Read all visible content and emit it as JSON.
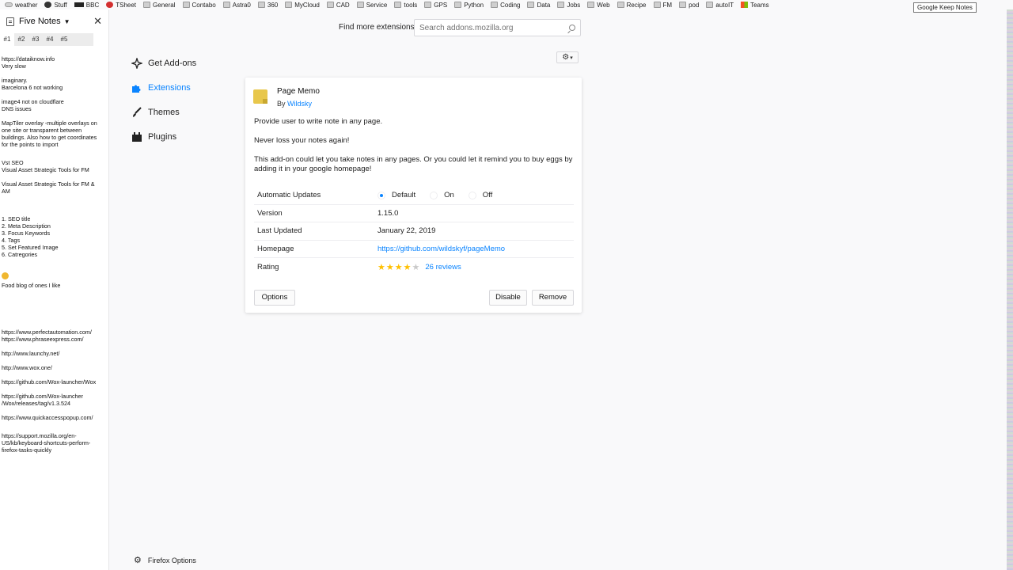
{
  "bookmarks": [
    {
      "label": "weather",
      "icon": "cloud"
    },
    {
      "label": "Stuff",
      "icon": "s"
    },
    {
      "label": "BBC",
      "icon": "bbc"
    },
    {
      "label": "TSheet",
      "icon": "t"
    },
    {
      "label": "General",
      "icon": "folder"
    },
    {
      "label": "Contabo",
      "icon": "folder"
    },
    {
      "label": "Astra0",
      "icon": "folder"
    },
    {
      "label": "360",
      "icon": "folder"
    },
    {
      "label": "MyCloud",
      "icon": "folder"
    },
    {
      "label": "CAD",
      "icon": "folder"
    },
    {
      "label": "Service",
      "icon": "folder"
    },
    {
      "label": "tools",
      "icon": "folder"
    },
    {
      "label": "GPS",
      "icon": "folder"
    },
    {
      "label": "Python",
      "icon": "folder"
    },
    {
      "label": "Coding",
      "icon": "folder"
    },
    {
      "label": "Data",
      "icon": "folder"
    },
    {
      "label": "Jobs",
      "icon": "folder"
    },
    {
      "label": "Web",
      "icon": "folder"
    },
    {
      "label": "Recipe",
      "icon": "folder"
    },
    {
      "label": "FM",
      "icon": "folder"
    },
    {
      "label": "pod",
      "icon": "folder"
    },
    {
      "label": "autoIT",
      "icon": "folder"
    },
    {
      "label": "Teams",
      "icon": "teams"
    }
  ],
  "tooltip": "Google Keep Notes",
  "sidebar": {
    "title": "Five Notes",
    "tabs": [
      "#1",
      "#2",
      "#3",
      "#4",
      "#5"
    ],
    "notes": [
      [
        "https://dataiknow.info",
        "Very slow"
      ],
      [
        "imaginary.",
        "Barcelona 6 not working"
      ],
      [
        "image4 not on cloudflare",
        "DNS issues"
      ],
      [
        "MapTiler overlay -multiple overlays on",
        "one site or transparent between",
        "buildings. Also how to get coordinates",
        "for the points to import"
      ],
      [
        "Vst SEO",
        "Visual Asset Strategic Tools for FM"
      ],
      [
        "Visual Asset Strategic Tools for FM &",
        "AM"
      ],
      [
        "1. SEO title",
        "2. Meta Description",
        "3. Focus Keywords",
        "4. Tags",
        "5. Set Featured Image",
        "6. Catregories"
      ],
      [
        "Food blog of ones I like"
      ],
      [
        "https://www.perfectautomation.com/",
        "https://www.phraseexpress.com/"
      ],
      [
        "http://www.launchy.net/"
      ],
      [
        "http://www.wox.one/"
      ],
      [
        "https://github.com/Wox-launcher/Wox"
      ],
      [
        "https://github.com/Wox-launcher",
        "/Wox/releases/tag/v1.3.524"
      ],
      [
        "https://www.quickaccesspopup.com/"
      ],
      [
        "https://support.mozilla.org/en-",
        "US/kb/keyboard-shortcuts-perform-",
        "firefox-tasks-quickly"
      ]
    ]
  },
  "header": {
    "find_more": "Find more extensions",
    "search_placeholder": "Search addons.mozilla.org"
  },
  "categories": [
    {
      "label": "Get Add-ons",
      "icon": "get-addons-icon",
      "active": false
    },
    {
      "label": "Extensions",
      "icon": "puzzle-icon",
      "active": true
    },
    {
      "label": "Themes",
      "icon": "brush-icon",
      "active": false
    },
    {
      "label": "Plugins",
      "icon": "plugin-icon",
      "active": false
    }
  ],
  "addon": {
    "name": "Page Memo",
    "by": "By",
    "author": "Wildsky",
    "description": [
      "Provide user to write note in any page.",
      "Never loss your notes again!",
      "This add-on could let you take notes in any pages. Or you could let it remind you to buy eggs by adding it in your google homepage!"
    ],
    "auto_updates_label": "Automatic Updates",
    "auto_updates_options": [
      "Default",
      "On",
      "Off"
    ],
    "auto_updates_selected": "Default",
    "version_label": "Version",
    "version": "1.15.0",
    "last_updated_label": "Last Updated",
    "last_updated": "January 22, 2019",
    "homepage_label": "Homepage",
    "homepage": "https://github.com/wildskyf/pageMemo",
    "rating_label": "Rating",
    "rating": 4.5,
    "reviews": "26 reviews",
    "options_button": "Options",
    "disable_button": "Disable",
    "remove_button": "Remove"
  },
  "footer": {
    "options": "Firefox Options"
  },
  "colors": {
    "accent": "#0a84ff",
    "star": "#ffc000"
  }
}
